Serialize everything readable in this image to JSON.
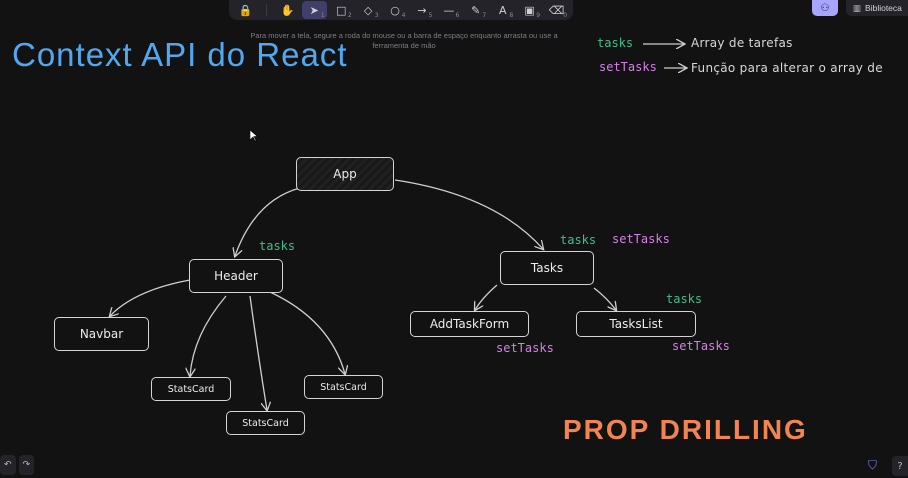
{
  "toolbar": {
    "tools": [
      {
        "name": "lock-icon",
        "glyph": "🔒",
        "num": ""
      },
      {
        "name": "hand-icon",
        "glyph": "✋",
        "num": ""
      },
      {
        "name": "selection-icon",
        "glyph": "➤",
        "num": "1"
      },
      {
        "name": "rectangle-icon",
        "glyph": "□",
        "num": "2"
      },
      {
        "name": "diamond-icon",
        "glyph": "◇",
        "num": "3"
      },
      {
        "name": "ellipse-icon",
        "glyph": "○",
        "num": "4"
      },
      {
        "name": "arrow-icon",
        "glyph": "→",
        "num": "5"
      },
      {
        "name": "line-icon",
        "glyph": "—",
        "num": "6"
      },
      {
        "name": "pencil-icon",
        "glyph": "✎",
        "num": "7"
      },
      {
        "name": "text-icon",
        "glyph": "A",
        "num": "8"
      },
      {
        "name": "image-icon",
        "glyph": "▣",
        "num": "9"
      },
      {
        "name": "eraser-icon",
        "glyph": "⌫",
        "num": "0"
      }
    ],
    "hint": "Para mover a tela, segure a roda do mouse ou a barra de espaço enquanto arrasta ou use a ferramenta de mão"
  },
  "header": {
    "library_label": "Biblioteca"
  },
  "canvas": {
    "title": "Context API do React",
    "legend": [
      {
        "key": "tasks",
        "desc": "Array de tarefas"
      },
      {
        "key": "setTasks",
        "desc": "Função para alterar o array de"
      }
    ],
    "nodes": {
      "app": "App",
      "header": "Header",
      "tasks": "Tasks",
      "navbar": "Navbar",
      "stats1": "StatsCard",
      "stats2": "StatsCard",
      "stats3": "StatsCard",
      "addtaskform": "AddTaskForm",
      "taskslist": "TasksList"
    },
    "labels": {
      "header_tasks": "tasks",
      "tasks_tasks": "tasks",
      "tasks_settasks": "setTasks",
      "taskslist_tasks": "tasks",
      "addtaskform_settasks": "setTasks",
      "taskslist_settasks": "setTasks"
    },
    "prop_drilling": "PROP DRILLING"
  },
  "colors": {
    "accent_blue": "#52a8f0",
    "prop_green": "#3fbf8a",
    "prop_purple": "#d77fe9",
    "orange": "#f28452"
  }
}
